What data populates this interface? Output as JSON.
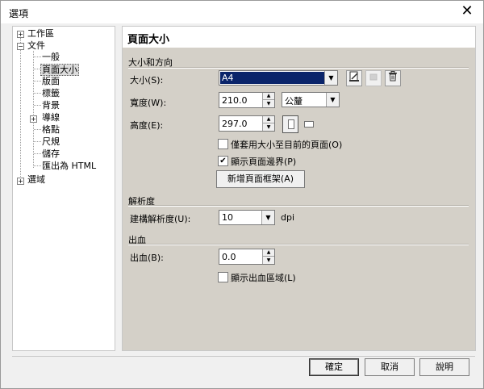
{
  "window": {
    "title": "選項",
    "close_glyph": "✕"
  },
  "tree": {
    "items": [
      {
        "label": "工作區",
        "expander": "+"
      },
      {
        "label": "文件",
        "expander": "−"
      },
      {
        "label": "一般"
      },
      {
        "label": "頁面大小"
      },
      {
        "label": "版面"
      },
      {
        "label": "標籤"
      },
      {
        "label": "背景"
      },
      {
        "label": "導線",
        "expander": "+"
      },
      {
        "label": "格點"
      },
      {
        "label": "尺規"
      },
      {
        "label": "儲存"
      },
      {
        "label": "匯出為 HTML"
      },
      {
        "label": "選域",
        "expander": "+"
      }
    ]
  },
  "page": {
    "title": "頁面大小"
  },
  "size_section": {
    "header": "大小和方向",
    "size_label": "大小(S):",
    "size_value": "A4",
    "icons": {
      "save": "save-page-icon",
      "disabled": "disabled-icon",
      "delete": "trash-icon"
    },
    "width_label": "寬度(W):",
    "width_value": "210.0",
    "unit_value": "公釐",
    "height_label": "高度(E):",
    "height_value": "297.0",
    "apply_current_label": "僅套用大小至目前的頁面(O)",
    "apply_current_checked": false,
    "show_border_label": "顯示頁面邊界(P)",
    "show_border_checked": true,
    "add_frame_label": "新增頁面框架(A)"
  },
  "resolution_section": {
    "header": "解析度",
    "render_label": "建構解析度(U):",
    "render_value": "10",
    "unit": "dpi"
  },
  "bleed_section": {
    "header": "出血",
    "bleed_label": "出血(B):",
    "bleed_value": "0.0",
    "show_bleed_label": "顯示出血區域(L)",
    "show_bleed_checked": false
  },
  "footer": {
    "ok": "確定",
    "cancel": "取消",
    "help": "說明"
  },
  "glyphs": {
    "dropdown": "▼",
    "up": "▲",
    "down": "▼",
    "check": "✔"
  }
}
